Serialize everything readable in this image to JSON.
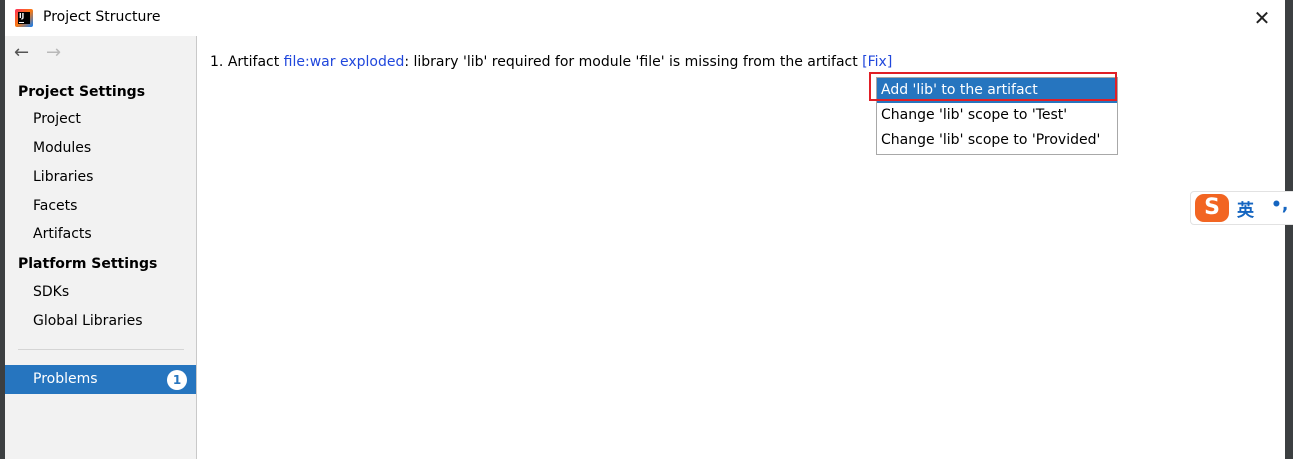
{
  "window": {
    "title": "Project Structure",
    "close_glyph": "✕",
    "icon": "intellij-idea-icon"
  },
  "nav": {
    "back_glyph": "←",
    "forward_glyph": "→"
  },
  "sidebar": {
    "project_settings_title": "Project Settings",
    "project_settings_items": [
      "Project",
      "Modules",
      "Libraries",
      "Facets",
      "Artifacts"
    ],
    "platform_settings_title": "Platform Settings",
    "platform_settings_items": [
      "SDKs",
      "Global Libraries"
    ],
    "problems": {
      "label": "Problems",
      "count": "1"
    }
  },
  "problem": {
    "number": "1.",
    "prefix": "Artifact",
    "artifact_link": "file:war exploded",
    "message": ": library 'lib' required for module 'file' is missing from the artifact",
    "fix_label": "[Fix]"
  },
  "fix_popup": {
    "items": [
      "Add 'lib' to the artifact",
      "Change 'lib' scope to 'Test'",
      "Change 'lib' scope to 'Provided'"
    ],
    "selected_index": 0
  },
  "ime_toolbar": {
    "logo": "S",
    "language": "英",
    "punctuation": "•,"
  },
  "colors": {
    "selection": "#2675bf",
    "link": "#2047dc",
    "highlight_border": "#e01f26",
    "ime_orange": "#f26522"
  }
}
